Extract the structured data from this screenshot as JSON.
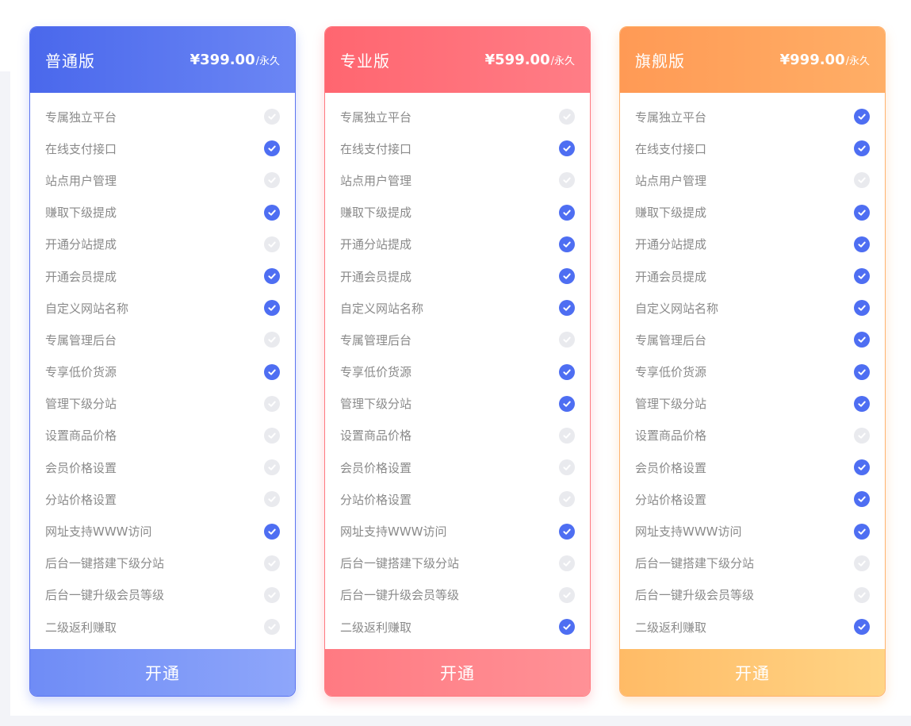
{
  "plans": [
    {
      "name": "普通版",
      "price": "¥399.00",
      "unit": "/永久",
      "button": "开通",
      "accent": "#4a68ec",
      "features": [
        {
          "label": "专属独立平台",
          "included": false
        },
        {
          "label": "在线支付接口",
          "included": true
        },
        {
          "label": "站点用户管理",
          "included": false
        },
        {
          "label": "赚取下级提成",
          "included": true
        },
        {
          "label": "开通分站提成",
          "included": false
        },
        {
          "label": "开通会员提成",
          "included": true
        },
        {
          "label": "自定义网站名称",
          "included": true
        },
        {
          "label": "专属管理后台",
          "included": false
        },
        {
          "label": "专享低价货源",
          "included": true
        },
        {
          "label": "管理下级分站",
          "included": false
        },
        {
          "label": "设置商品价格",
          "included": false
        },
        {
          "label": "会员价格设置",
          "included": false
        },
        {
          "label": "分站价格设置",
          "included": false
        },
        {
          "label": "网址支持WWW访问",
          "included": true
        },
        {
          "label": "后台一键搭建下级分站",
          "included": false
        },
        {
          "label": "后台一键升级会员等级",
          "included": false
        },
        {
          "label": "二级返利赚取",
          "included": false
        }
      ]
    },
    {
      "name": "专业版",
      "price": "¥599.00",
      "unit": "/永久",
      "button": "开通",
      "accent": "#ff6670",
      "features": [
        {
          "label": "专属独立平台",
          "included": false
        },
        {
          "label": "在线支付接口",
          "included": true
        },
        {
          "label": "站点用户管理",
          "included": false
        },
        {
          "label": "赚取下级提成",
          "included": true
        },
        {
          "label": "开通分站提成",
          "included": true
        },
        {
          "label": "开通会员提成",
          "included": true
        },
        {
          "label": "自定义网站名称",
          "included": true
        },
        {
          "label": "专属管理后台",
          "included": false
        },
        {
          "label": "专享低价货源",
          "included": true
        },
        {
          "label": "管理下级分站",
          "included": true
        },
        {
          "label": "设置商品价格",
          "included": false
        },
        {
          "label": "会员价格设置",
          "included": false
        },
        {
          "label": "分站价格设置",
          "included": false
        },
        {
          "label": "网址支持WWW访问",
          "included": true
        },
        {
          "label": "后台一键搭建下级分站",
          "included": false
        },
        {
          "label": "后台一键升级会员等级",
          "included": false
        },
        {
          "label": "二级返利赚取",
          "included": true
        }
      ]
    },
    {
      "name": "旗舰版",
      "price": "¥999.00",
      "unit": "/永久",
      "button": "开通",
      "accent": "#ff9a55",
      "features": [
        {
          "label": "专属独立平台",
          "included": true
        },
        {
          "label": "在线支付接口",
          "included": true
        },
        {
          "label": "站点用户管理",
          "included": false
        },
        {
          "label": "赚取下级提成",
          "included": true
        },
        {
          "label": "开通分站提成",
          "included": true
        },
        {
          "label": "开通会员提成",
          "included": true
        },
        {
          "label": "自定义网站名称",
          "included": true
        },
        {
          "label": "专属管理后台",
          "included": true
        },
        {
          "label": "专享低价货源",
          "included": true
        },
        {
          "label": "管理下级分站",
          "included": true
        },
        {
          "label": "设置商品价格",
          "included": false
        },
        {
          "label": "会员价格设置",
          "included": true
        },
        {
          "label": "分站价格设置",
          "included": true
        },
        {
          "label": "网址支持WWW访问",
          "included": true
        },
        {
          "label": "后台一键搭建下级分站",
          "included": false
        },
        {
          "label": "后台一键升级会员等级",
          "included": false
        },
        {
          "label": "二级返利赚取",
          "included": true
        }
      ]
    }
  ],
  "check_icon": "check-circle-icon",
  "check_on_color": "#4e6ef2",
  "check_off_color": "#e9eaee"
}
